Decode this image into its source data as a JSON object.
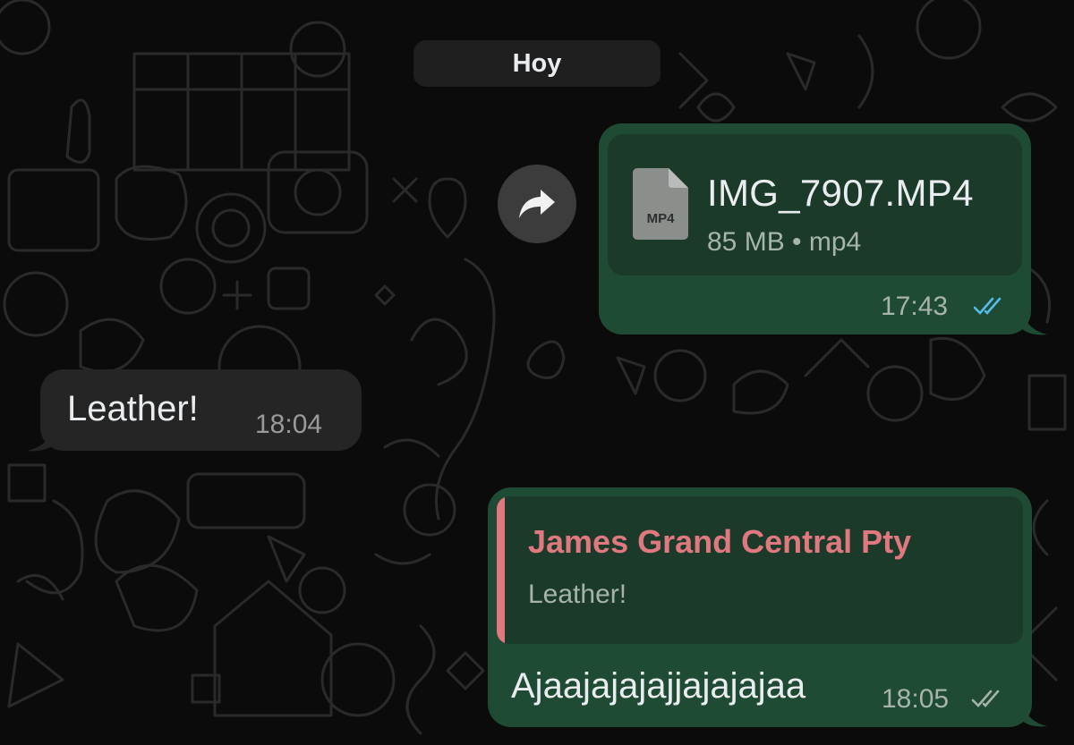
{
  "date_separator": "Hoy",
  "messages": [
    {
      "direction": "outgoing",
      "type": "file",
      "file_name": "IMG_7907.MP4",
      "file_icon_label": "MP4",
      "file_meta": "85 MB • mp4",
      "time": "17:43",
      "status": "read",
      "status_icon": "double-check-icon"
    },
    {
      "direction": "incoming",
      "type": "text",
      "text": "Leather!",
      "time": "18:04"
    },
    {
      "direction": "outgoing",
      "type": "reply",
      "quote_author": "James Grand Central Pty",
      "quote_text": "Leather!",
      "text": "Ajaajajajajjajajajaa",
      "time": "18:05",
      "status": "delivered",
      "status_icon": "double-check-icon"
    }
  ],
  "colors": {
    "background": "#0b0b0b",
    "outgoing_bubble": "#1f4a33",
    "incoming_bubble": "#252525",
    "quote_accent": "#e0787f",
    "read_ticks": "#53bdeb",
    "delivered_ticks": "#a6b4ac"
  },
  "icons": {
    "forward": "forward-arrow-icon",
    "file": "document-file-icon"
  }
}
